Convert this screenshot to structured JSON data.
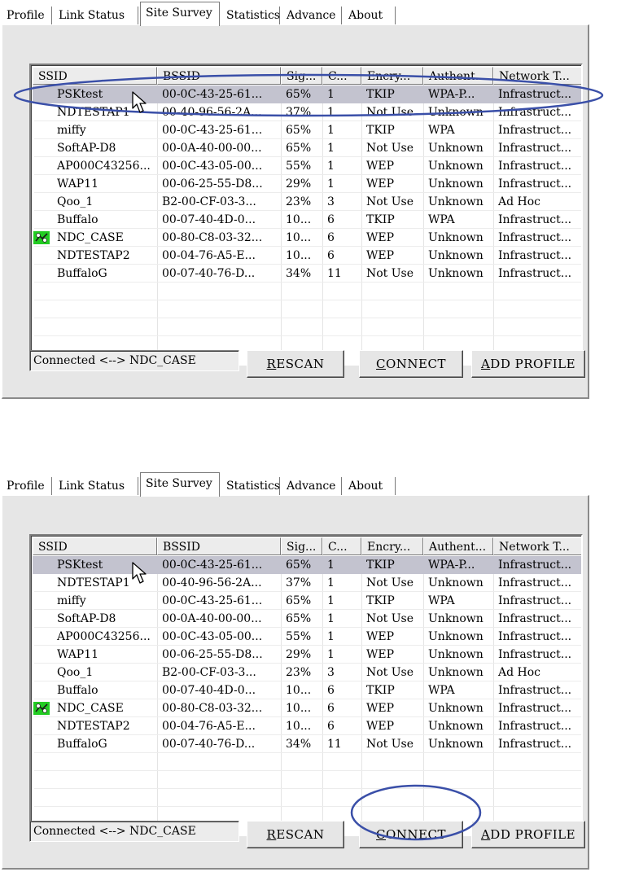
{
  "tabs": [
    "Profile",
    "Link Status",
    "Site Survey",
    "Statistics",
    "Advance",
    "About"
  ],
  "active_tab": "Site Survey",
  "columns": [
    "SSID",
    "BSSID",
    "Sig...",
    "C...",
    "Encry...",
    "Authent...",
    "Network T..."
  ],
  "networks": [
    {
      "ssid": "PSKtest",
      "bssid": "00-0C-43-25-61...",
      "signal": "65%",
      "channel": "1",
      "encryption": "TKIP",
      "auth": "WPA-P...",
      "network_type": "Infrastruct..."
    },
    {
      "ssid": "NDTESTAP1",
      "bssid": "00-40-96-56-2A...",
      "signal": "37%",
      "channel": "1",
      "encryption": "Not Use",
      "auth": "Unknown",
      "network_type": "Infrastruct..."
    },
    {
      "ssid": "miffy",
      "bssid": "00-0C-43-25-61...",
      "signal": "65%",
      "channel": "1",
      "encryption": "TKIP",
      "auth": "WPA",
      "network_type": "Infrastruct..."
    },
    {
      "ssid": "SoftAP-D8",
      "bssid": "00-0A-40-00-00...",
      "signal": "65%",
      "channel": "1",
      "encryption": "Not Use",
      "auth": "Unknown",
      "network_type": "Infrastruct..."
    },
    {
      "ssid": "AP000C43256...",
      "bssid": "00-0C-43-05-00...",
      "signal": "55%",
      "channel": "1",
      "encryption": "WEP",
      "auth": "Unknown",
      "network_type": "Infrastruct..."
    },
    {
      "ssid": "WAP11",
      "bssid": "00-06-25-55-D8...",
      "signal": "29%",
      "channel": "1",
      "encryption": "WEP",
      "auth": "Unknown",
      "network_type": "Infrastruct..."
    },
    {
      "ssid": "Qoo_1",
      "bssid": "B2-00-CF-03-3...",
      "signal": "23%",
      "channel": "3",
      "encryption": "Not Use",
      "auth": "Unknown",
      "network_type": "Ad Hoc"
    },
    {
      "ssid": "Buffalo",
      "bssid": "00-07-40-4D-0...",
      "signal": "10...",
      "channel": "6",
      "encryption": "TKIP",
      "auth": "WPA",
      "network_type": "Infrastruct..."
    },
    {
      "ssid": "NDC_CASE",
      "bssid": "00-80-C8-03-32...",
      "signal": "10...",
      "channel": "6",
      "encryption": "WEP",
      "auth": "Unknown",
      "network_type": "Infrastruct...",
      "connected": true
    },
    {
      "ssid": "NDTESTAP2",
      "bssid": "00-04-76-A5-E...",
      "signal": "10...",
      "channel": "6",
      "encryption": "WEP",
      "auth": "Unknown",
      "network_type": "Infrastruct..."
    },
    {
      "ssid": "BuffaloG",
      "bssid": "00-07-40-76-D...",
      "signal": "34%",
      "channel": "11",
      "encryption": "Not Use",
      "auth": "Unknown",
      "network_type": "Infrastruct..."
    }
  ],
  "selected_network": "PSKtest",
  "status": "Connected <--> NDC_CASE",
  "buttons": {
    "rescan": {
      "accel": "R",
      "rest": "ESCAN"
    },
    "connect": {
      "accel": "C",
      "rest": "ONNECT"
    },
    "add_profile": {
      "accel": "A",
      "rest": "DD PROFILE"
    }
  },
  "icons": {
    "connected": "connected-network-icon",
    "cursor": "mouse-pointer-icon"
  },
  "colors": {
    "selection": "#c3c3cf",
    "annotation": "#3a4fa8",
    "connected_icon": "#22cc22"
  },
  "annotations": [
    "selected-row-highlight",
    "connect-button-highlight"
  ]
}
